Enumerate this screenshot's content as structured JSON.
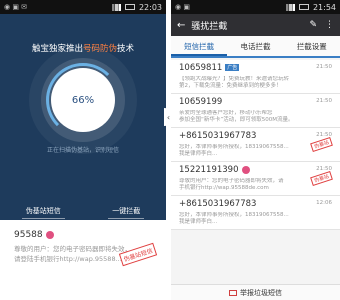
{
  "left": {
    "status_time": "22:03",
    "headline_pre": "触宝独家推出",
    "headline_accent": "号码防伪",
    "headline_post": "技术",
    "dial_value": "66%",
    "subnote": "正在扫描伪基站，识别短信",
    "action_left": "伪基站短信",
    "action_right": "一键拦截",
    "card_number": "95588",
    "card_body_1": "尊敬的用户：您的电子密码器即将失效，",
    "card_body_2": "请登陆手机银行http://wap.95588...",
    "card_stamp": "伪基站短信"
  },
  "right": {
    "status_time": "21:54",
    "title": "骚扰拦截",
    "tabs": [
      "短信拦截",
      "电话拦截",
      "拦截设置"
    ],
    "rows": [
      {
        "number": "10659811",
        "tag": "广告",
        "time": "21:50",
        "line1": "【领跑大战曝光？】免费玩教！来邀请您玩转",
        "line2": "第2，下载免流量：免费继承到的梗多多！",
        "stamp": ""
      },
      {
        "number": "10659199",
        "tag": "",
        "time": "21:50",
        "line1": "亲爱的全球通客户您好，移动小乐帮您",
        "line2": "参加全国“新华卡”活动，即可领取500M流量。",
        "stamp": ""
      },
      {
        "number": "+8615031967783",
        "tag": "",
        "time": "21:50",
        "line1": "您好，本律师事务所授权，18319067558...",
        "line2": "我是律师李白...",
        "stamp": "伪基站"
      },
      {
        "number": "15221191390",
        "tag": "",
        "time": "21:50",
        "line1": "尊敬的用户：您的电子密码器即将失效，请",
        "line2": "手机银行http://wap.95588de.com",
        "stamp": "伪基站"
      },
      {
        "number": "+8615031967783",
        "tag": "",
        "time": "12:06",
        "line1": "您好，本律师事务所授权，18319067558...",
        "line2": "我是律师李白...",
        "stamp": ""
      }
    ],
    "bottom_label": "举报垃圾短信"
  }
}
